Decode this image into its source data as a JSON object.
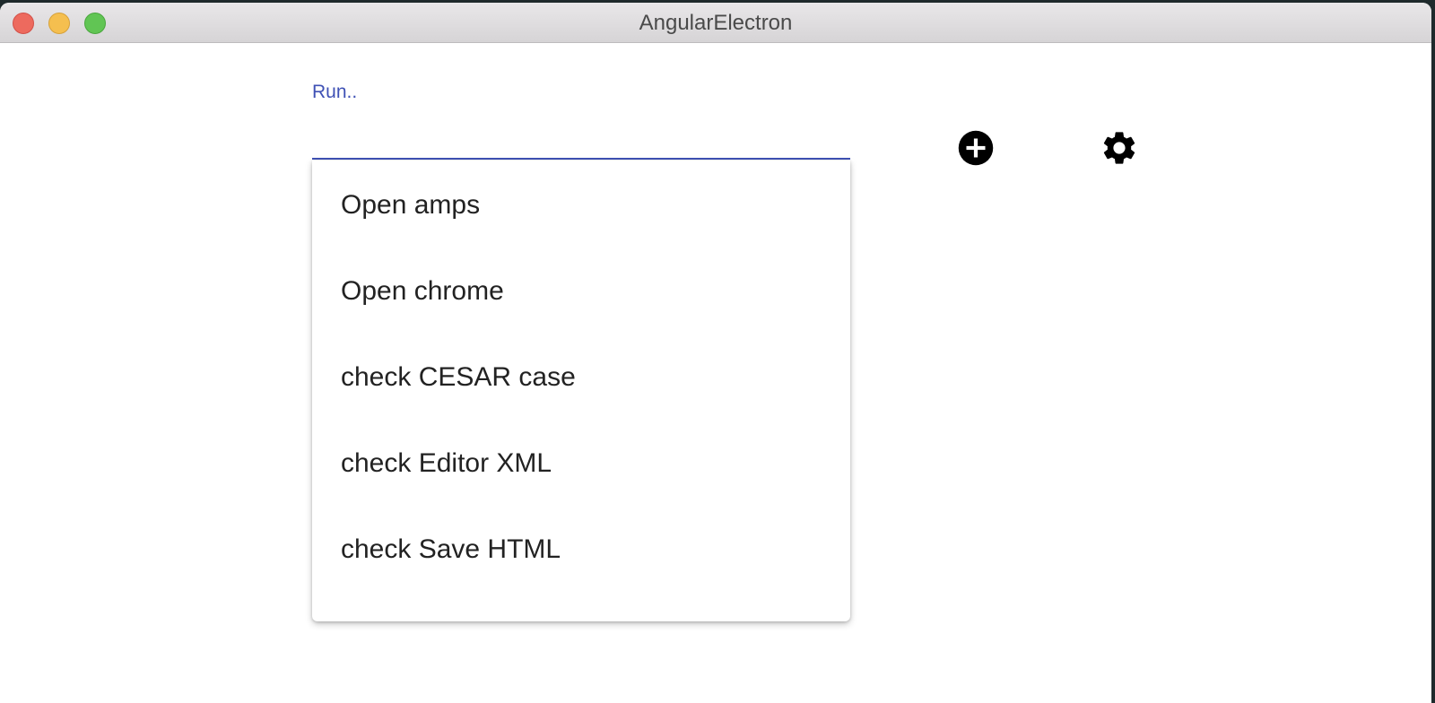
{
  "window": {
    "title": "AngularElectron"
  },
  "run_field": {
    "label": "Run..",
    "value": "",
    "accent_color": "#3f51b5"
  },
  "dropdown": {
    "options": [
      "Open amps",
      "Open chrome",
      "check CESAR case",
      "check Editor XML",
      "check Save HTML"
    ]
  },
  "toolbar": {
    "add_icon": "plus-circle-icon",
    "settings_icon": "gear-icon"
  }
}
